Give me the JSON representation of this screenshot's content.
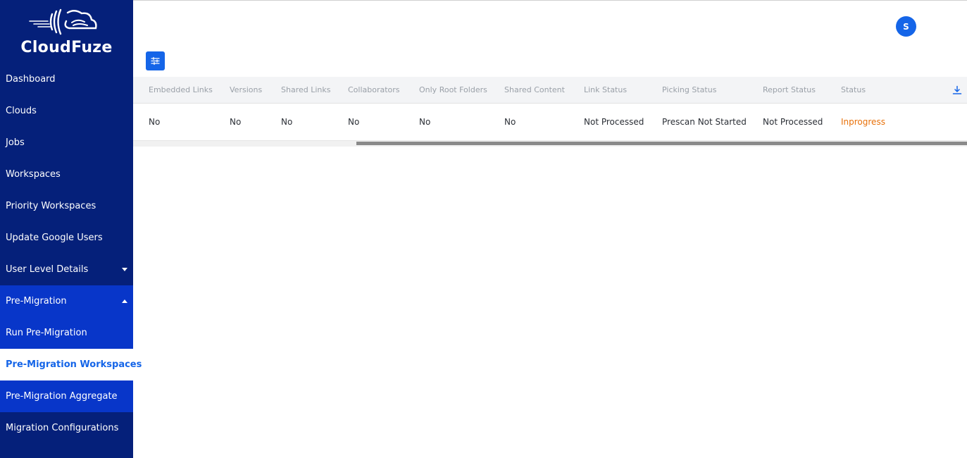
{
  "brand": {
    "name": "CloudFuze",
    "logo": "cloudfuze-logo"
  },
  "sidebar": {
    "items": [
      {
        "label": "Dashboard"
      },
      {
        "label": "Clouds"
      },
      {
        "label": "Jobs"
      },
      {
        "label": "Workspaces"
      },
      {
        "label": "Priority Workspaces"
      },
      {
        "label": "Update Google Users"
      },
      {
        "label": "User Level Details",
        "caret": "down"
      },
      {
        "label": "Pre-Migration",
        "caret": "up",
        "expanded": true
      },
      {
        "label": "Run Pre-Migration",
        "sub": true
      },
      {
        "label": "Pre-Migration Workspaces",
        "sub": true,
        "active": true
      },
      {
        "label": "Pre-Migration Aggregate",
        "sub": true
      },
      {
        "label": "Migration Configurations"
      }
    ]
  },
  "header": {
    "avatar_initial": "S",
    "filter_icon": "sliders-icon"
  },
  "table": {
    "columns": [
      "Embedded Links",
      "Versions",
      "Shared Links",
      "Collaborators",
      "Only Root Folders",
      "Shared Content",
      "Link Status",
      "Picking Status",
      "Report Status",
      "Status"
    ],
    "rows": [
      [
        "No",
        "No",
        "No",
        "No",
        "No",
        "No",
        "Not Processed",
        "Prescan Not Started",
        "Not Processed",
        "Inprogress"
      ]
    ],
    "download_icon": "download-icon"
  },
  "colors": {
    "sidebar_bg": "#05207a",
    "sidebar_sub_bg": "#0836c9",
    "accent": "#1565e8",
    "status_inprogress": "#e8710a"
  }
}
